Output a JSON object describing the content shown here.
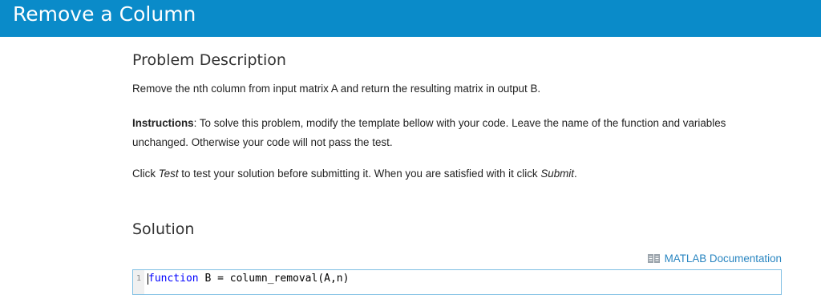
{
  "header": {
    "title": "Remove a Column"
  },
  "problem": {
    "heading": "Problem Description",
    "description": "Remove the nth column from input matrix A and return the resulting matrix in output B.",
    "instructions_label": "Instructions",
    "instructions_text": ": To solve this problem, modify the template bellow with your code. Leave the name of the function and variables unchanged. Otherwise your code will not pass the test.",
    "click_prefix": "Click ",
    "test_word": "Test",
    "click_middle": " to test your solution before submitting it. When you are satisfied with it click ",
    "submit_word": "Submit",
    "click_suffix": "."
  },
  "solution": {
    "heading": "Solution",
    "doc_link": "MATLAB Documentation",
    "editor": {
      "line_number": "1",
      "keyword": "function",
      "code_rest": " B = column_removal(A,n)"
    }
  },
  "colors": {
    "header_bg": "#0a8bc9",
    "link": "#2a86c1",
    "editor_border": "#7fbfe4",
    "keyword": "#0000ff"
  }
}
